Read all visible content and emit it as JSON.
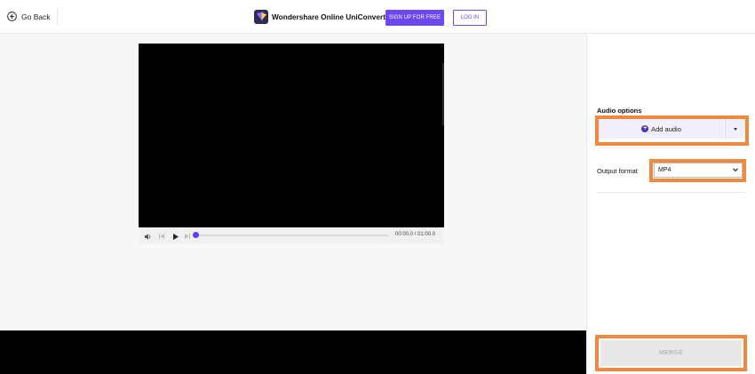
{
  "header": {
    "go_back_label": "Go Back",
    "brand_name": "Wondershare Online UniConverter",
    "signup_label": "SIGN UP FOR FREE",
    "login_label": "LOG IN"
  },
  "player": {
    "timecode": "00:00.0 / 01:00.0",
    "progress": 0.0
  },
  "panel": {
    "audio_title": "Audio options",
    "add_audio_label": "Add audio",
    "output_format_label": "Output format",
    "output_format_value": "MP4",
    "merge_label": "MERGE"
  },
  "colors": {
    "accent": "#6c48f2",
    "highlight": "#f0883e"
  }
}
